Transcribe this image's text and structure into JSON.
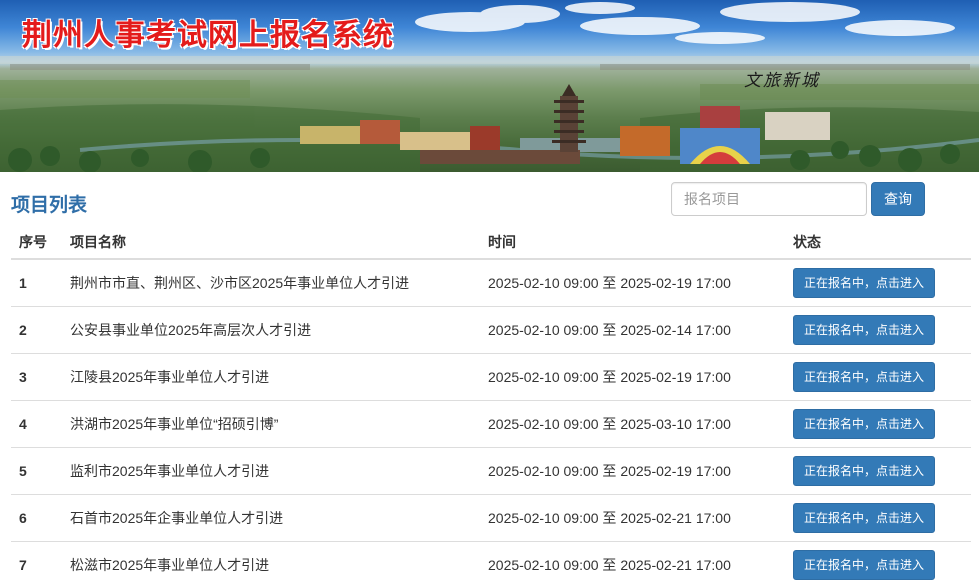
{
  "banner": {
    "title": "荆州人事考试网上报名系统",
    "tagline": "文旅新城"
  },
  "list": {
    "title": "项目列表"
  },
  "search": {
    "placeholder": "报名项目",
    "button_label": "查询"
  },
  "table": {
    "columns": [
      "序号",
      "项目名称",
      "时间",
      "状态"
    ],
    "rows": [
      {
        "no": "1",
        "name": "荆州市市直、荆州区、沙市区2025年事业单位人才引进",
        "time": "2025-02-10 09:00 至 2025-02-19 17:00",
        "status": "正在报名中，点击进入"
      },
      {
        "no": "2",
        "name": "公安县事业单位2025年高层次人才引进",
        "time": "2025-02-10 09:00 至 2025-02-14 17:00",
        "status": "正在报名中，点击进入"
      },
      {
        "no": "3",
        "name": "江陵县2025年事业单位人才引进",
        "time": "2025-02-10 09:00 至 2025-02-19 17:00",
        "status": "正在报名中，点击进入"
      },
      {
        "no": "4",
        "name": "洪湖市2025年事业单位“招硕引博”",
        "time": "2025-02-10 09:00 至 2025-03-10 17:00",
        "status": "正在报名中，点击进入"
      },
      {
        "no": "5",
        "name": "监利市2025年事业单位人才引进",
        "time": "2025-02-10 09:00 至 2025-02-19 17:00",
        "status": "正在报名中，点击进入"
      },
      {
        "no": "6",
        "name": "石首市2025年企事业单位人才引进",
        "time": "2025-02-10 09:00 至 2025-02-21 17:00",
        "status": "正在报名中，点击进入"
      },
      {
        "no": "7",
        "name": "松滋市2025年事业单位人才引进",
        "time": "2025-02-10 09:00 至 2025-02-21 17:00",
        "status": "正在报名中，点击进入"
      }
    ]
  },
  "colors": {
    "brand_blue": "#337ab7",
    "title_red": "#e41b1b",
    "heading_blue": "#2f6ea8"
  }
}
